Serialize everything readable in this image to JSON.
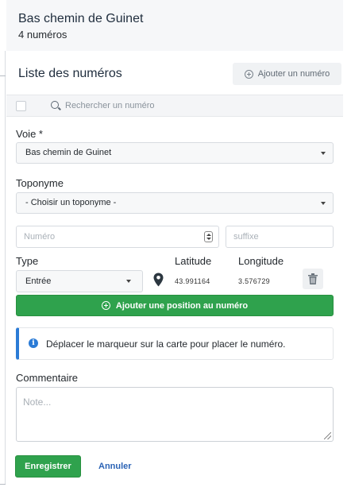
{
  "header": {
    "title": "Bas chemin de Guinet",
    "count": "4 numéros"
  },
  "list": {
    "title": "Liste des numéros",
    "add_button": "Ajouter un numéro"
  },
  "search": {
    "placeholder": "Rechercher un numéro"
  },
  "form": {
    "voie_label": "Voie *",
    "voie_value": "Bas chemin de Guinet",
    "toponyme_label": "Toponyme",
    "toponyme_value": "- Choisir un toponyme -",
    "numero_placeholder": "Numéro",
    "suffixe_placeholder": "suffixe",
    "type_label": "Type",
    "latitude_label": "Latitude",
    "longitude_label": "Longitude",
    "type_value": "Entrée",
    "latitude_value": "43.991164",
    "longitude_value": "3.576729",
    "add_position_button": "Ajouter une position au numéro",
    "info_message": "Déplacer le marqueur sur la carte pour placer le numéro.",
    "comment_label": "Commentaire",
    "comment_placeholder": "Note...",
    "save_button": "Enregistrer",
    "cancel_button": "Annuler"
  },
  "colors": {
    "primary_green": "#2fa24d",
    "info_blue": "#2b7bd6",
    "link_blue": "#2b63b5"
  },
  "icons": [
    "add-circle-icon",
    "search-icon",
    "caret-down-icon",
    "stepper-icon",
    "map-marker-icon",
    "trash-icon",
    "info-icon",
    "resize-grip-icon"
  ]
}
